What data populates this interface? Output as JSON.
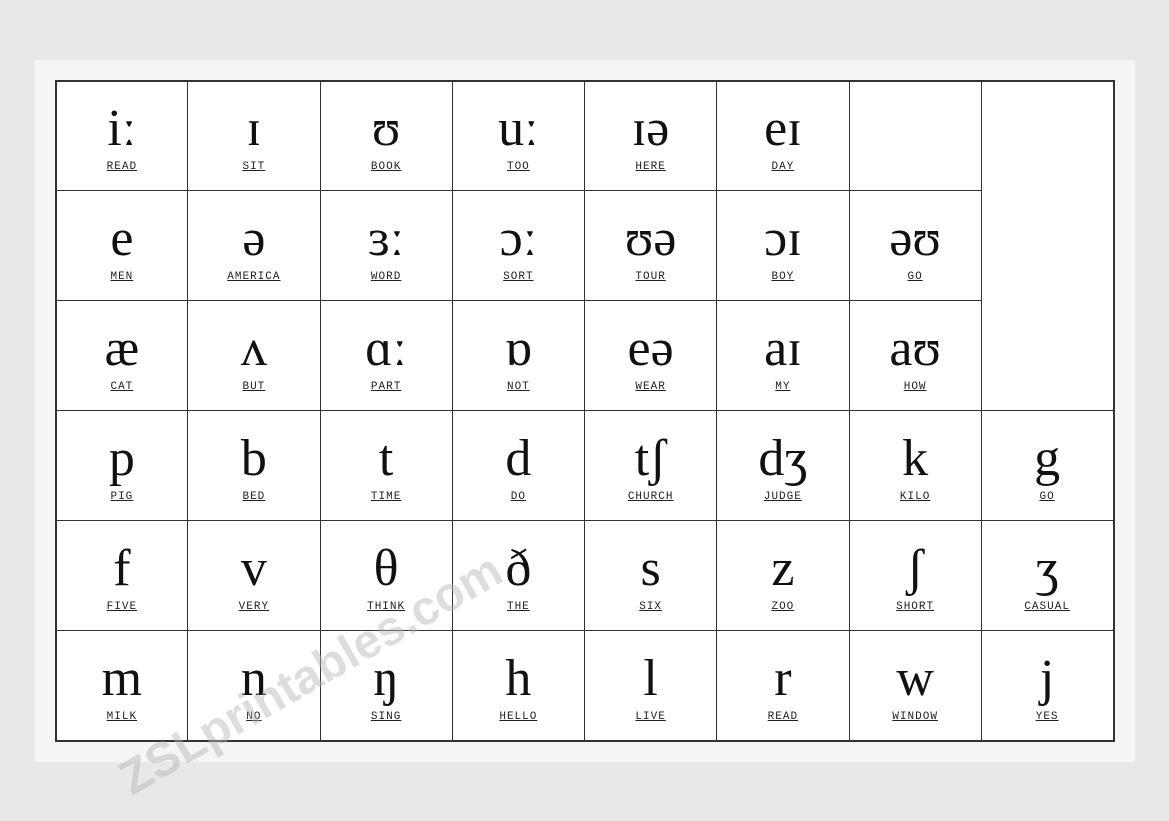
{
  "watermark": "ZSLprintables.com",
  "table": {
    "rows": [
      {
        "cells": [
          {
            "symbol": "iː",
            "word": "READ",
            "underline": true
          },
          {
            "symbol": "ɪ",
            "word": "SIT",
            "underline": true
          },
          {
            "symbol": "ʊ",
            "word": "BOOK",
            "underline": true
          },
          {
            "symbol": "uː",
            "word": "TOO",
            "underline": true
          },
          {
            "symbol": "ɪə",
            "word": "HERE",
            "underline": true
          },
          {
            "symbol": "eɪ",
            "word": "DAY",
            "underline": true
          },
          {
            "symbol": "",
            "word": "",
            "empty": true
          }
        ]
      },
      {
        "cells": [
          {
            "symbol": "e",
            "word": "MEN",
            "underline": true
          },
          {
            "symbol": "ə",
            "word": "AMERICA",
            "underline": true
          },
          {
            "symbol": "ɜː",
            "word": "WORD",
            "underline": true
          },
          {
            "symbol": "ɔː",
            "word": "SORT",
            "underline": true
          },
          {
            "symbol": "ʊə",
            "word": "TOUR",
            "underline": true
          },
          {
            "symbol": "ɔɪ",
            "word": "BOY",
            "underline": true
          },
          {
            "symbol": "əʊ",
            "word": "GO",
            "underline": true
          }
        ]
      },
      {
        "cells": [
          {
            "symbol": "æ",
            "word": "CAT",
            "underline": true
          },
          {
            "symbol": "ʌ",
            "word": "BUT",
            "underline": true
          },
          {
            "symbol": "ɑː",
            "word": "PART",
            "underline": true
          },
          {
            "symbol": "ɒ",
            "word": "NOT",
            "underline": true
          },
          {
            "symbol": "eə",
            "word": "WEAR",
            "underline": true
          },
          {
            "symbol": "aɪ",
            "word": "MY",
            "underline": true
          },
          {
            "symbol": "aʊ",
            "word": "HOW",
            "underline": true
          }
        ]
      },
      {
        "cells": [
          {
            "symbol": "p",
            "word": "PIG",
            "underline": true
          },
          {
            "symbol": "b",
            "word": "BED",
            "underline": true
          },
          {
            "symbol": "t",
            "word": "TIME",
            "underline": true
          },
          {
            "symbol": "d",
            "word": "DO",
            "underline": true
          },
          {
            "symbol": "tʃ",
            "word": "CHURCH",
            "underline": true
          },
          {
            "symbol": "dʒ",
            "word": "JUDGE",
            "underline": true
          },
          {
            "symbol": "k",
            "word": "KILO",
            "underline": true
          },
          {
            "symbol": "g",
            "word": "GO",
            "underline": true
          }
        ]
      },
      {
        "cells": [
          {
            "symbol": "f",
            "word": "FIVE",
            "underline": true
          },
          {
            "symbol": "v",
            "word": "VERY",
            "underline": true
          },
          {
            "symbol": "θ",
            "word": "THINK",
            "underline": true
          },
          {
            "symbol": "ð",
            "word": "THE",
            "underline": true
          },
          {
            "symbol": "s",
            "word": "SIX",
            "underline": true
          },
          {
            "symbol": "z",
            "word": "ZOO",
            "underline": true
          },
          {
            "symbol": "ʃ",
            "word": "SHORT",
            "underline": true
          },
          {
            "symbol": "ʒ",
            "word": "CASUAL",
            "underline": true
          }
        ]
      },
      {
        "cells": [
          {
            "symbol": "m",
            "word": "MILK",
            "underline": true
          },
          {
            "symbol": "n",
            "word": "NO",
            "underline": true
          },
          {
            "symbol": "ŋ",
            "word": "SING",
            "underline": true
          },
          {
            "symbol": "h",
            "word": "HELLO",
            "underline": true
          },
          {
            "symbol": "l",
            "word": "LIVE",
            "underline": true
          },
          {
            "symbol": "r",
            "word": "READ",
            "underline": true
          },
          {
            "symbol": "w",
            "word": "WINDOW",
            "underline": true
          },
          {
            "symbol": "j",
            "word": "YES",
            "underline": true
          }
        ]
      }
    ]
  }
}
